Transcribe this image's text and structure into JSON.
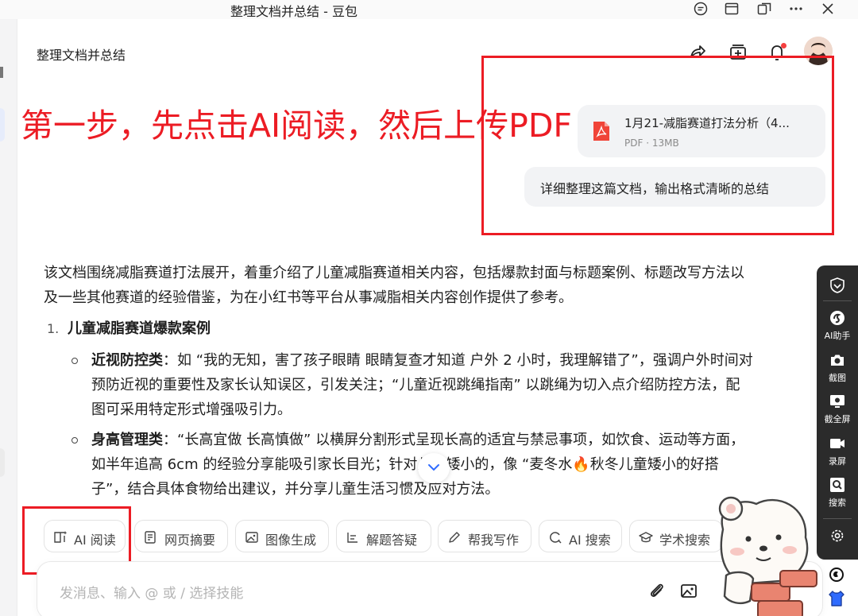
{
  "window": {
    "title": "整理文档并总结 - 豆包"
  },
  "header": {
    "title": "整理文档并总结"
  },
  "annotation": {
    "step_text": "第一步，先点击AI阅读，然后上传PDF",
    "color": "#ec1c24"
  },
  "conversation": {
    "file": {
      "name": "1月21-减脂赛道打法分析（4...",
      "meta": "PDF · 13MB",
      "icon": "pdf-icon"
    },
    "user_message": "详细整理这篇文档，输出格式清晰的总结"
  },
  "answer": {
    "intro_line1": "该文档围绕减脂赛道打法展开，着重介绍了儿童减脂赛道相关内容，包括爆款封面与标题案例、标题改写方法以",
    "intro_line2": "及一些其他赛道的经验借鉴，为在小红书等平台从事减脂相关内容创作提供了参考。",
    "section1": {
      "number": "1.",
      "title": "儿童减脂赛道爆款案例"
    },
    "bullet1": {
      "label": "近视防控类",
      "line1": "：如 “我的无知，害了孩子眼睛 眼睛复查才知道 户外 2 小时，我理解错了”，强调户外时间对",
      "line2": "预防近视的重要性及家长认知误区，引发关注；“儿童近视跳绳指南” 以跳绳为切入点介绍防控方法，配",
      "line3": "图可采用特定形式增强吸引力。"
    },
    "bullet2": {
      "label": "身高管理类",
      "line1": "：“长高宜做 长高慎做” 以横屏分割形式呈现长高的适宜与禁忌事项，如饮食、运动等方面，",
      "line2": "如半年追高 6cm 的经验分享能吸引家长目光；针对儿童矮小的，像 “麦冬水🔥秋冬儿童矮小的好搭",
      "line3": "子”，结合具体食物给出建议，并分享儿童生活习惯及应对方法。"
    }
  },
  "skills": [
    {
      "label": "AI 阅读",
      "icon": "ai-read-icon"
    },
    {
      "label": "网页摘要",
      "icon": "web-summary-icon"
    },
    {
      "label": "图像生成",
      "icon": "image-gen-icon"
    },
    {
      "label": "解题答疑",
      "icon": "solve-icon"
    },
    {
      "label": "帮我写作",
      "icon": "write-icon"
    },
    {
      "label": "AI 搜索",
      "icon": "ai-search-icon"
    },
    {
      "label": "学术搜索",
      "icon": "academic-search-icon"
    }
  ],
  "composer": {
    "placeholder": "发消息、输入 @ 或 / 选择技能"
  },
  "side_toolbar": {
    "items": [
      {
        "label": "AI助手",
        "icon": "ai-assistant-icon"
      },
      {
        "label": "截图",
        "icon": "camera-icon"
      },
      {
        "label": "截全屏",
        "icon": "fullscreen-capture-icon"
      },
      {
        "label": "录屏",
        "icon": "record-icon"
      },
      {
        "label": "搜索",
        "icon": "search-icon"
      }
    ]
  }
}
